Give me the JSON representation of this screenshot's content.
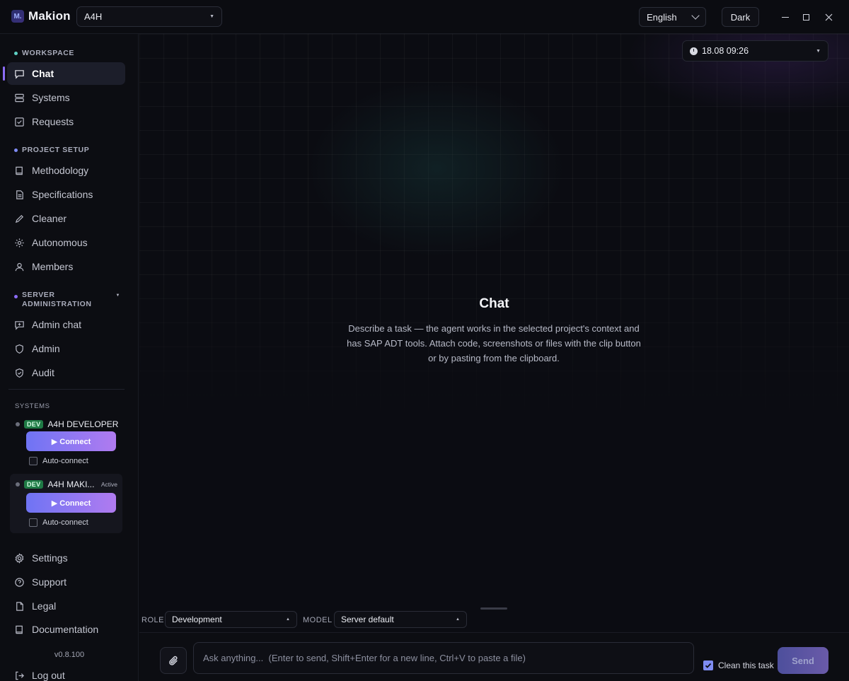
{
  "app": {
    "logo_mark": "M.",
    "name": "Makion"
  },
  "header": {
    "project": "A4H",
    "language": "English",
    "theme": "Dark"
  },
  "sidebar": {
    "workspace_title": "WORKSPACE",
    "workspace_items": [
      {
        "label": "Chat",
        "icon": "chat-icon",
        "active": true
      },
      {
        "label": "Systems",
        "icon": "server-icon"
      },
      {
        "label": "Requests",
        "icon": "checkbox-icon"
      }
    ],
    "project_title": "PROJECT SETUP",
    "project_items": [
      {
        "label": "Methodology",
        "icon": "book-icon"
      },
      {
        "label": "Specifications",
        "icon": "document-icon"
      },
      {
        "label": "Cleaner",
        "icon": "pencil-icon"
      },
      {
        "label": "Autonomous",
        "icon": "sun-icon"
      },
      {
        "label": "Members",
        "icon": "user-icon"
      }
    ],
    "admin_title_line1": "SERVER",
    "admin_title_line2": "ADMINISTRATION",
    "admin_items": [
      {
        "label": "Admin chat",
        "icon": "message-plus-icon"
      },
      {
        "label": "Admin",
        "icon": "shield-icon"
      },
      {
        "label": "Audit",
        "icon": "shield-check-icon"
      }
    ],
    "systems_title": "SYSTEMS",
    "systems": [
      {
        "badge": "DEV",
        "name": "A4H DEVELOPER",
        "status": "",
        "connect_label": "▶ Connect",
        "auto_label": "Auto-connect"
      },
      {
        "badge": "DEV",
        "name": "A4H MAKI...",
        "status": "Active",
        "connect_label": "▶ Connect",
        "auto_label": "Auto-connect"
      }
    ],
    "bottom_items": [
      {
        "label": "Settings",
        "icon": "gear-icon"
      },
      {
        "label": "Support",
        "icon": "help-circle-icon"
      },
      {
        "label": "Legal",
        "icon": "file-icon"
      },
      {
        "label": "Documentation",
        "icon": "book-icon"
      }
    ],
    "version": "v0.8.100",
    "logout": "Log out"
  },
  "main": {
    "date": "18.08 09:26",
    "title": "Chat",
    "description": "Describe a task — the agent works in the selected project's context and has SAP ADT tools. Attach code, screenshots or files with the clip button or by pasting from the clipboard.",
    "role_label": "ROLE",
    "role_value": "Development",
    "model_label": "MODEL",
    "model_value": "Server default"
  },
  "composer": {
    "placeholder": "Ask anything...  (Enter to send, Shift+Enter for a new line, Ctrl+V to paste a file)",
    "clean_label": "Clean this task",
    "clean_checked": true,
    "send_label": "Send"
  },
  "colors": {
    "accent": "#8b6cf6",
    "background": "#0a0b10",
    "dev_badge": "#1f7a45",
    "connect_gradient_start": "#6f74f4",
    "connect_gradient_end": "#b07bf0"
  }
}
